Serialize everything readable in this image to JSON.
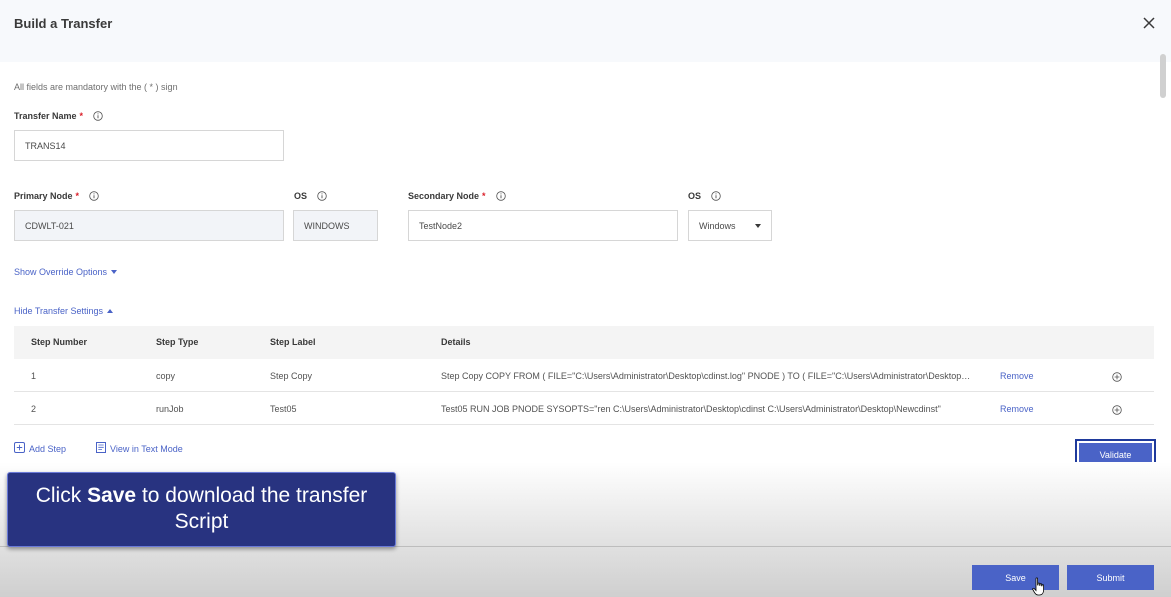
{
  "modal": {
    "title": "Build a Transfer",
    "mandatory_note": "All fields are mandatory with the ( * ) sign"
  },
  "transfer_name": {
    "label": "Transfer Name",
    "required": "*",
    "value": "TRANS14"
  },
  "primary_node": {
    "label": "Primary Node",
    "required": "*",
    "value": "CDWLT-021"
  },
  "primary_os": {
    "label": "OS",
    "value": "WINDOWS"
  },
  "secondary_node": {
    "label": "Secondary Node",
    "required": "*",
    "value": "TestNode2"
  },
  "secondary_os": {
    "label": "OS",
    "value": "Windows"
  },
  "links": {
    "show_override": "Show Override Options",
    "hide_transfer": "Hide Transfer Settings",
    "add_step": "Add Step",
    "view_text_mode": "View in Text Mode"
  },
  "table": {
    "headers": [
      "Step Number",
      "Step Type",
      "Step Label",
      "Details"
    ],
    "rows": [
      {
        "number": "1",
        "type": "copy",
        "label": "Step Copy",
        "details": "Step Copy COPY FROM ( FILE=\"C:\\Users\\Administrator\\Desktop\\cdinst.log\" PNODE ) TO ( FILE=\"C:\\Users\\Administrator\\Desktop\\...",
        "remove": "Remove"
      },
      {
        "number": "2",
        "type": "runJob",
        "label": "Test05",
        "details": "Test05 RUN JOB PNODE SYSOPTS=\"ren C:\\Users\\Administrator\\Desktop\\cdinst C:\\Users\\Administrator\\Desktop\\Newcdinst\"",
        "remove": "Remove"
      }
    ]
  },
  "buttons": {
    "validate": "Validate",
    "save": "Save",
    "submit": "Submit"
  },
  "tooltip": {
    "prefix": "Click ",
    "bold": "Save",
    "suffix": " to download the transfer Script"
  },
  "colors": {
    "primary": "#4a63c7",
    "tooltip_bg": "#283380",
    "required": "#da1e28"
  }
}
